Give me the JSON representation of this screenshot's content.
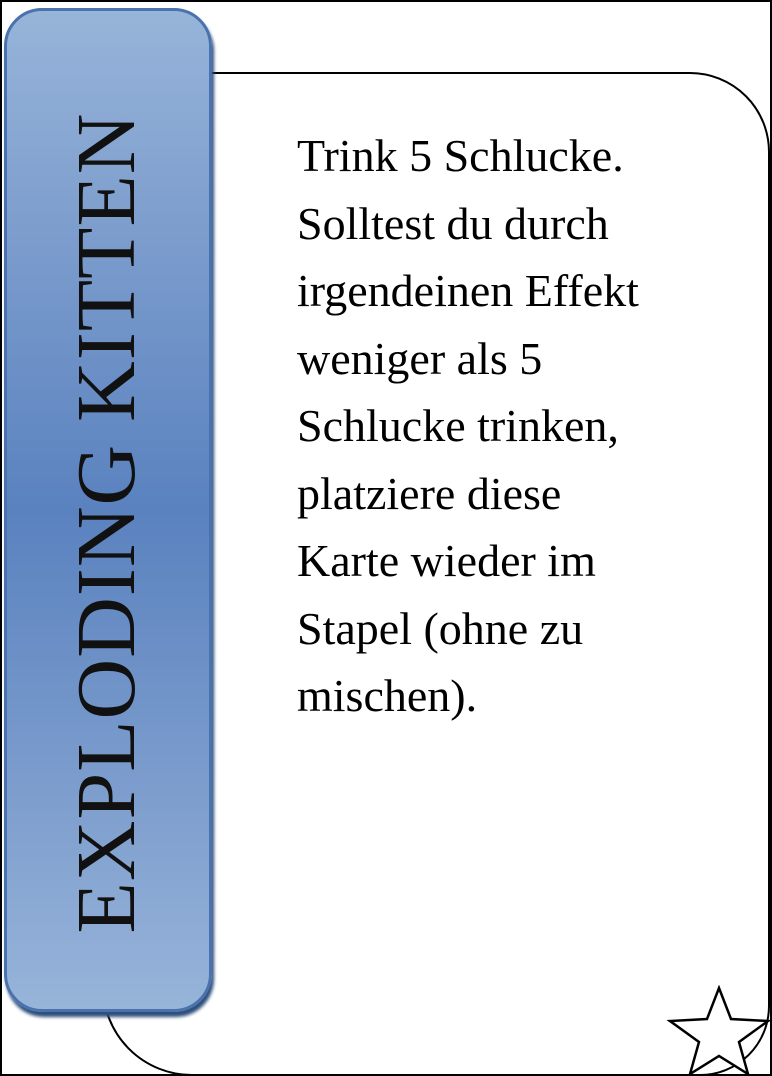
{
  "card": {
    "title": "EXPLODING KITTEN",
    "text_lines": [
      "Trink 5 Schlucke.",
      "Solltest du durch",
      "irgendeinen Effekt",
      "weniger als 5",
      "Schlucke trinken,",
      "platziere diese",
      "Karte wieder im",
      "Stapel (ohne zu",
      "mischen)."
    ],
    "icon": "star-icon"
  },
  "colors": {
    "banner_light": "#97b4d9",
    "banner_dark": "#5a82bf",
    "banner_border": "#4a72ad",
    "outline": "#000000"
  }
}
